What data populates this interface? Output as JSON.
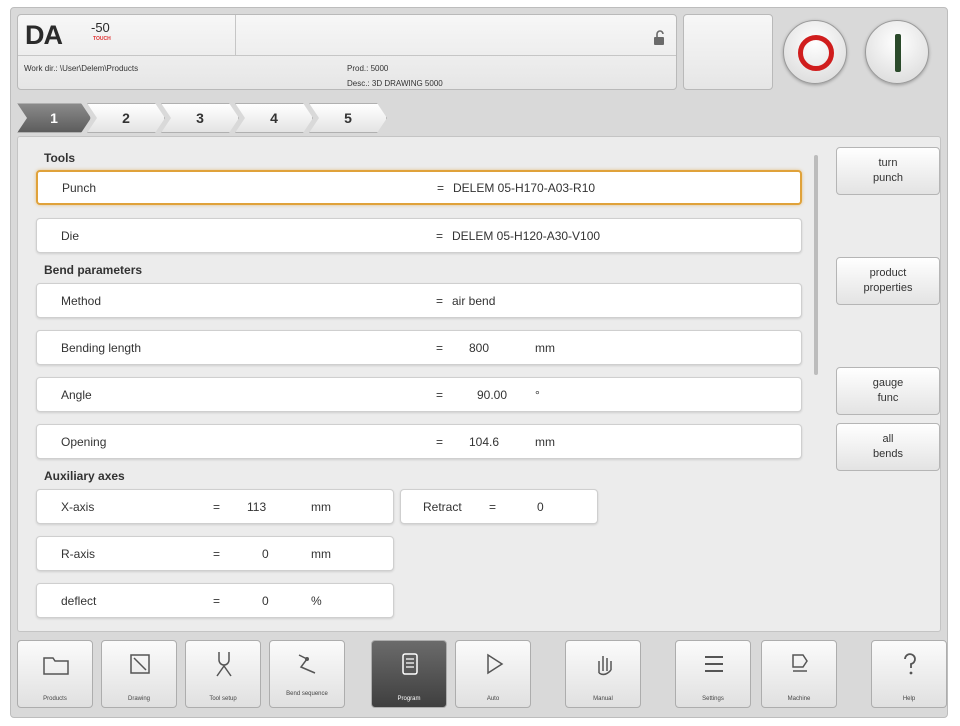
{
  "header": {
    "logo": "DA",
    "logo_model": "-50",
    "logo_sub": "TOUCH",
    "work_dir": "Work dir.: \\User\\Delem\\Products",
    "prod": "Prod.: 5000",
    "desc": "Desc.: 3D DRAWING 5000"
  },
  "tabs": [
    "1",
    "2",
    "3",
    "4",
    "5"
  ],
  "sections": {
    "tools": "Tools",
    "bend_parameters": "Bend parameters",
    "auxiliary_axes": "Auxiliary axes"
  },
  "rows": {
    "punch": {
      "label": "Punch",
      "eq": "=",
      "value": "DELEM 05-H170-A03-R10"
    },
    "die": {
      "label": "Die",
      "eq": "=",
      "value": "DELEM 05-H120-A30-V100"
    },
    "method": {
      "label": "Method",
      "eq": "=",
      "value": "air bend"
    },
    "bending_length": {
      "label": "Bending length",
      "eq": "=",
      "value": "800",
      "unit": "mm"
    },
    "angle": {
      "label": "Angle",
      "eq": "=",
      "value": "90.00",
      "unit": "°"
    },
    "opening": {
      "label": "Opening",
      "eq": "=",
      "value": "104.6",
      "unit": "mm"
    },
    "x_axis": {
      "label": "X-axis",
      "eq": "=",
      "value": "113",
      "unit": "mm"
    },
    "retract": {
      "label": "Retract",
      "eq": "=",
      "value": "0"
    },
    "r_axis": {
      "label": "R-axis",
      "eq": "=",
      "value": "0",
      "unit": "mm"
    },
    "deflect": {
      "label": "deflect",
      "eq": "=",
      "value": "0",
      "unit": "%"
    }
  },
  "side_buttons": {
    "turn_punch": "turn\npunch",
    "product_properties": "product\nproperties",
    "gauge_func": "gauge\nfunc",
    "all_bends": "all\nbends"
  },
  "toolbar": [
    {
      "label": "Products",
      "icon": "folder-icon"
    },
    {
      "label": "Drawing",
      "icon": "pencil-icon"
    },
    {
      "label": "Tool setup",
      "icon": "tool-setup-icon"
    },
    {
      "label": "Bend sequence",
      "icon": "bend-sequence-icon"
    },
    {
      "label": "Program",
      "icon": "program-icon"
    },
    {
      "label": "Auto",
      "icon": "play-icon"
    },
    {
      "label": "Manual",
      "icon": "hand-icon"
    },
    {
      "label": "Settings",
      "icon": "settings-icon"
    },
    {
      "label": "Machine",
      "icon": "machine-icon"
    },
    {
      "label": "Help",
      "icon": "help-icon"
    }
  ],
  "colors": {
    "selection_border": "#e0a23a",
    "stop_red": "#d01d1d",
    "start_dark": "#2b4a2b",
    "active_tab": "#5d5d5d"
  }
}
